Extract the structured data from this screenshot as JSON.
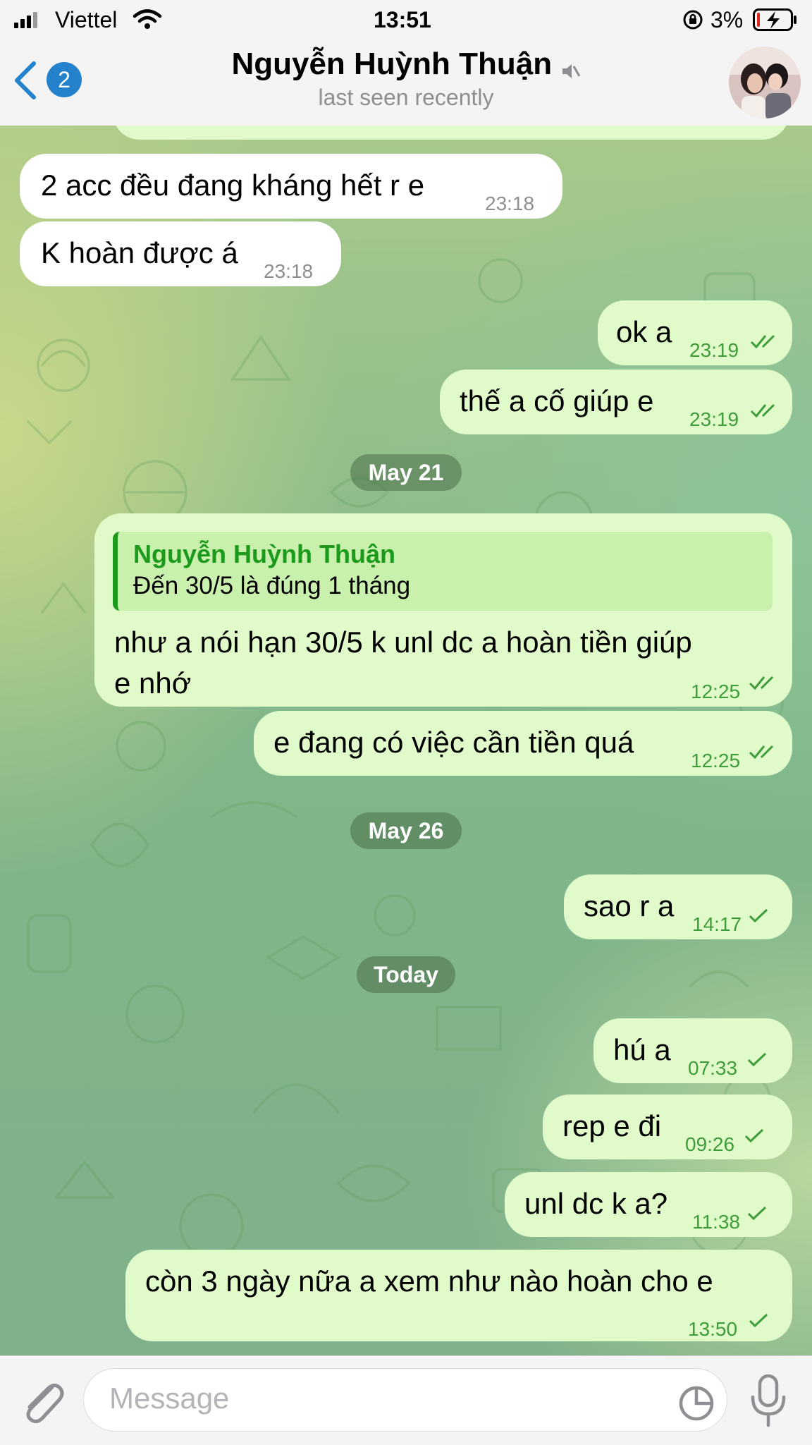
{
  "status_bar": {
    "carrier": "Viettel",
    "time": "13:51",
    "battery": "3%"
  },
  "header": {
    "back_count": "2",
    "contact_name": "Nguyễn Huỳnh Thuận",
    "subtitle": "last seen recently",
    "icons": [
      "chevron-left-icon",
      "muted-speaker-icon",
      "avatar"
    ]
  },
  "messages": [
    {
      "dir": "in",
      "text": "2 acc đều đang kháng hết r e",
      "time": "23:18"
    },
    {
      "dir": "in",
      "text": "K hoàn được á",
      "time": "23:18"
    },
    {
      "dir": "out",
      "text": "ok a",
      "time": "23:19",
      "status": "read"
    },
    {
      "dir": "out",
      "text": "thế a cố giúp e",
      "time": "23:19",
      "status": "read"
    },
    {
      "date": "May 21"
    },
    {
      "dir": "out",
      "reply_name": "Nguyễn Huỳnh Thuận",
      "reply_text": "Đến 30/5 là đúng 1 tháng",
      "text_line1": "như a nói hạn 30/5 k unl dc a hoàn tiền giúp",
      "text_line2": "e nhớ",
      "time": "12:25",
      "status": "read"
    },
    {
      "dir": "out",
      "text": "e đang có việc cần tiền quá",
      "time": "12:25",
      "status": "read"
    },
    {
      "date": "May 26"
    },
    {
      "dir": "out",
      "text": "sao r a",
      "time": "14:17",
      "status": "sent"
    },
    {
      "date": "Today"
    },
    {
      "dir": "out",
      "text": "hú a",
      "time": "07:33",
      "status": "sent"
    },
    {
      "dir": "out",
      "text": "rep e đi",
      "time": "09:26",
      "status": "sent"
    },
    {
      "dir": "out",
      "text": "unl dc k a?",
      "time": "11:38",
      "status": "sent"
    },
    {
      "dir": "out",
      "text": "còn 3 ngày nữa a xem như nào hoàn cho e",
      "time": "13:50",
      "status": "sent"
    }
  ],
  "input": {
    "placeholder": "Message",
    "icons": [
      "paperclip-icon",
      "sticker-icon",
      "microphone-icon"
    ]
  },
  "colors": {
    "accent": "#2481cc",
    "outgoing_bubble": "#e0fbc9",
    "incoming_bubble": "#ffffff",
    "outgoing_time": "#3f9c3a",
    "reply_name": "#1c9a1c"
  }
}
